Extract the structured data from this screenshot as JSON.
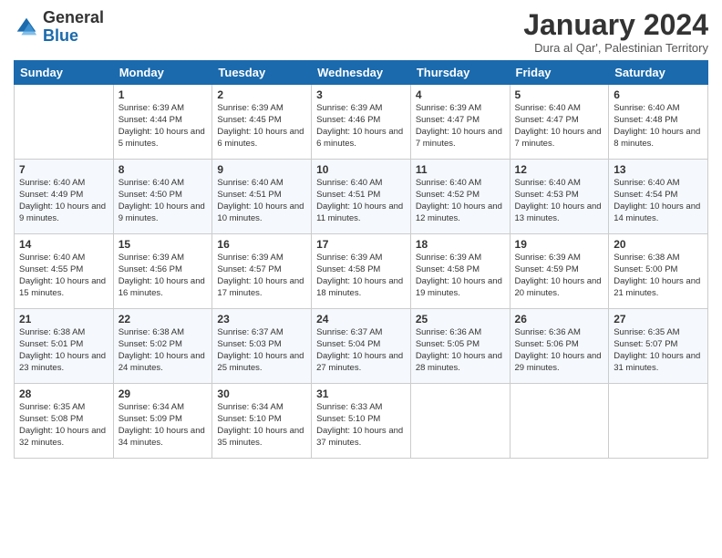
{
  "logo": {
    "general": "General",
    "blue": "Blue"
  },
  "header": {
    "title": "January 2024",
    "location": "Dura al Qar', Palestinian Territory"
  },
  "columns": [
    "Sunday",
    "Monday",
    "Tuesday",
    "Wednesday",
    "Thursday",
    "Friday",
    "Saturday"
  ],
  "weeks": [
    [
      {
        "day": "",
        "sunrise": "",
        "sunset": "",
        "daylight": ""
      },
      {
        "day": "1",
        "sunrise": "Sunrise: 6:39 AM",
        "sunset": "Sunset: 4:44 PM",
        "daylight": "Daylight: 10 hours and 5 minutes."
      },
      {
        "day": "2",
        "sunrise": "Sunrise: 6:39 AM",
        "sunset": "Sunset: 4:45 PM",
        "daylight": "Daylight: 10 hours and 6 minutes."
      },
      {
        "day": "3",
        "sunrise": "Sunrise: 6:39 AM",
        "sunset": "Sunset: 4:46 PM",
        "daylight": "Daylight: 10 hours and 6 minutes."
      },
      {
        "day": "4",
        "sunrise": "Sunrise: 6:39 AM",
        "sunset": "Sunset: 4:47 PM",
        "daylight": "Daylight: 10 hours and 7 minutes."
      },
      {
        "day": "5",
        "sunrise": "Sunrise: 6:40 AM",
        "sunset": "Sunset: 4:47 PM",
        "daylight": "Daylight: 10 hours and 7 minutes."
      },
      {
        "day": "6",
        "sunrise": "Sunrise: 6:40 AM",
        "sunset": "Sunset: 4:48 PM",
        "daylight": "Daylight: 10 hours and 8 minutes."
      }
    ],
    [
      {
        "day": "7",
        "sunrise": "Sunrise: 6:40 AM",
        "sunset": "Sunset: 4:49 PM",
        "daylight": "Daylight: 10 hours and 9 minutes."
      },
      {
        "day": "8",
        "sunrise": "Sunrise: 6:40 AM",
        "sunset": "Sunset: 4:50 PM",
        "daylight": "Daylight: 10 hours and 9 minutes."
      },
      {
        "day": "9",
        "sunrise": "Sunrise: 6:40 AM",
        "sunset": "Sunset: 4:51 PM",
        "daylight": "Daylight: 10 hours and 10 minutes."
      },
      {
        "day": "10",
        "sunrise": "Sunrise: 6:40 AM",
        "sunset": "Sunset: 4:51 PM",
        "daylight": "Daylight: 10 hours and 11 minutes."
      },
      {
        "day": "11",
        "sunrise": "Sunrise: 6:40 AM",
        "sunset": "Sunset: 4:52 PM",
        "daylight": "Daylight: 10 hours and 12 minutes."
      },
      {
        "day": "12",
        "sunrise": "Sunrise: 6:40 AM",
        "sunset": "Sunset: 4:53 PM",
        "daylight": "Daylight: 10 hours and 13 minutes."
      },
      {
        "day": "13",
        "sunrise": "Sunrise: 6:40 AM",
        "sunset": "Sunset: 4:54 PM",
        "daylight": "Daylight: 10 hours and 14 minutes."
      }
    ],
    [
      {
        "day": "14",
        "sunrise": "Sunrise: 6:40 AM",
        "sunset": "Sunset: 4:55 PM",
        "daylight": "Daylight: 10 hours and 15 minutes."
      },
      {
        "day": "15",
        "sunrise": "Sunrise: 6:39 AM",
        "sunset": "Sunset: 4:56 PM",
        "daylight": "Daylight: 10 hours and 16 minutes."
      },
      {
        "day": "16",
        "sunrise": "Sunrise: 6:39 AM",
        "sunset": "Sunset: 4:57 PM",
        "daylight": "Daylight: 10 hours and 17 minutes."
      },
      {
        "day": "17",
        "sunrise": "Sunrise: 6:39 AM",
        "sunset": "Sunset: 4:58 PM",
        "daylight": "Daylight: 10 hours and 18 minutes."
      },
      {
        "day": "18",
        "sunrise": "Sunrise: 6:39 AM",
        "sunset": "Sunset: 4:58 PM",
        "daylight": "Daylight: 10 hours and 19 minutes."
      },
      {
        "day": "19",
        "sunrise": "Sunrise: 6:39 AM",
        "sunset": "Sunset: 4:59 PM",
        "daylight": "Daylight: 10 hours and 20 minutes."
      },
      {
        "day": "20",
        "sunrise": "Sunrise: 6:38 AM",
        "sunset": "Sunset: 5:00 PM",
        "daylight": "Daylight: 10 hours and 21 minutes."
      }
    ],
    [
      {
        "day": "21",
        "sunrise": "Sunrise: 6:38 AM",
        "sunset": "Sunset: 5:01 PM",
        "daylight": "Daylight: 10 hours and 23 minutes."
      },
      {
        "day": "22",
        "sunrise": "Sunrise: 6:38 AM",
        "sunset": "Sunset: 5:02 PM",
        "daylight": "Daylight: 10 hours and 24 minutes."
      },
      {
        "day": "23",
        "sunrise": "Sunrise: 6:37 AM",
        "sunset": "Sunset: 5:03 PM",
        "daylight": "Daylight: 10 hours and 25 minutes."
      },
      {
        "day": "24",
        "sunrise": "Sunrise: 6:37 AM",
        "sunset": "Sunset: 5:04 PM",
        "daylight": "Daylight: 10 hours and 27 minutes."
      },
      {
        "day": "25",
        "sunrise": "Sunrise: 6:36 AM",
        "sunset": "Sunset: 5:05 PM",
        "daylight": "Daylight: 10 hours and 28 minutes."
      },
      {
        "day": "26",
        "sunrise": "Sunrise: 6:36 AM",
        "sunset": "Sunset: 5:06 PM",
        "daylight": "Daylight: 10 hours and 29 minutes."
      },
      {
        "day": "27",
        "sunrise": "Sunrise: 6:35 AM",
        "sunset": "Sunset: 5:07 PM",
        "daylight": "Daylight: 10 hours and 31 minutes."
      }
    ],
    [
      {
        "day": "28",
        "sunrise": "Sunrise: 6:35 AM",
        "sunset": "Sunset: 5:08 PM",
        "daylight": "Daylight: 10 hours and 32 minutes."
      },
      {
        "day": "29",
        "sunrise": "Sunrise: 6:34 AM",
        "sunset": "Sunset: 5:09 PM",
        "daylight": "Daylight: 10 hours and 34 minutes."
      },
      {
        "day": "30",
        "sunrise": "Sunrise: 6:34 AM",
        "sunset": "Sunset: 5:10 PM",
        "daylight": "Daylight: 10 hours and 35 minutes."
      },
      {
        "day": "31",
        "sunrise": "Sunrise: 6:33 AM",
        "sunset": "Sunset: 5:10 PM",
        "daylight": "Daylight: 10 hours and 37 minutes."
      },
      {
        "day": "",
        "sunrise": "",
        "sunset": "",
        "daylight": ""
      },
      {
        "day": "",
        "sunrise": "",
        "sunset": "",
        "daylight": ""
      },
      {
        "day": "",
        "sunrise": "",
        "sunset": "",
        "daylight": ""
      }
    ]
  ]
}
